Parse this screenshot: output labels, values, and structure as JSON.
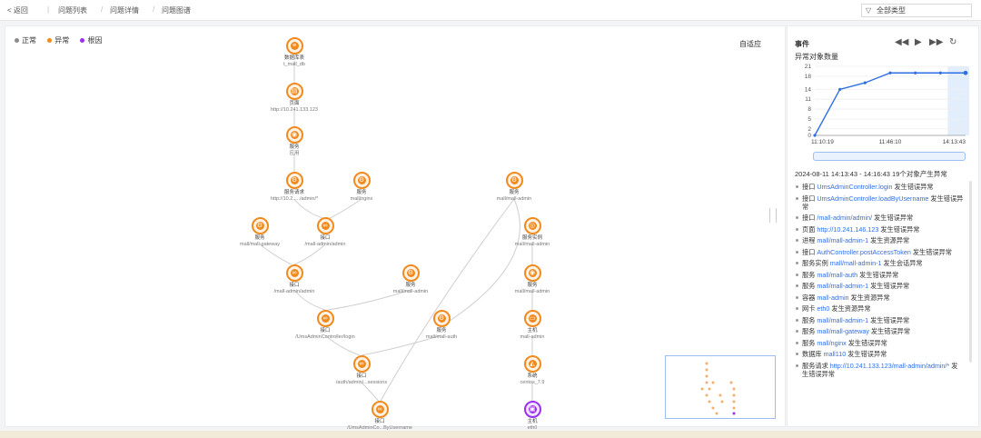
{
  "header": {
    "back": "< 返回",
    "breadcrumb": [
      "问题列表",
      "问题详情",
      "问题图谱"
    ],
    "filter_label": "全部类型"
  },
  "canvas": {
    "legend": [
      {
        "label": "正常",
        "color": "#8c8c8c"
      },
      {
        "label": "异常",
        "color": "#f08a1e"
      },
      {
        "label": "根因",
        "color": "#9b30f0"
      }
    ],
    "reset_label": "自适应",
    "nodes": [
      {
        "title": "数据库表",
        "sub": "t_mall_db"
      },
      {
        "title": "页面",
        "sub": "http://10.241.133.123"
      },
      {
        "title": "服务",
        "sub": "应用"
      },
      {
        "title": "服务请求",
        "sub": "http://10.2...../admin/*"
      },
      {
        "title": "服务",
        "sub": "mall/nginx"
      },
      {
        "title": "服务",
        "sub": "mall/mall-admin"
      },
      {
        "title": "服务",
        "sub": "mall/mall-gateway"
      },
      {
        "title": "接口",
        "sub": "/mall-admin/admin"
      },
      {
        "title": "服务实例",
        "sub": "mall/mall-admin"
      },
      {
        "title": "接口",
        "sub": "/mall-admin/admin"
      },
      {
        "title": "服务",
        "sub": "mall/mall-admin"
      },
      {
        "title": "服务",
        "sub": "mall/mall-admin"
      },
      {
        "title": "接口",
        "sub": "/UmsAdminController/login"
      },
      {
        "title": "服务",
        "sub": "mall/mall-auth"
      },
      {
        "title": "主机",
        "sub": "mall-admin"
      },
      {
        "title": "接口",
        "sub": "/auth/admin/...sessions"
      },
      {
        "title": "系统",
        "sub": "centos_7.9"
      },
      {
        "title": "接口",
        "sub": "/UmsAdminCo...ByUsername"
      },
      {
        "title": "主机",
        "sub": "eth0"
      }
    ]
  },
  "panel": {
    "title": "事件",
    "chart_title": "异常对象数量",
    "summary": "2024-08-11 14:13:43 - 14:16:43 19个对象产生异常",
    "events": [
      {
        "pre": "接口",
        "res": "UmsAdminController.login",
        "post": " 发生错误异常"
      },
      {
        "pre": "接口",
        "res": "UmsAdminController.loadByUsername",
        "post": " 发生错误异常"
      },
      {
        "pre": "接口",
        "res": "/mall-admin/admin/",
        "post": " 发生错误异常"
      },
      {
        "pre": "页面",
        "res": "http://10.241.146.123",
        "post": " 发生错误异常"
      },
      {
        "pre": "进程",
        "res": "mall/mall-admin-1",
        "post": " 发生资源异常"
      },
      {
        "pre": "接口",
        "res": "AuthController.postAccessToken",
        "post": " 发生错误异常"
      },
      {
        "pre": "服务实例",
        "res": "mall/mall-admin-1",
        "post": " 发生会话异常"
      },
      {
        "pre": "服务",
        "res": "mall/mall-auth",
        "post": " 发生错误异常"
      },
      {
        "pre": "服务",
        "res": "mall/mall-admin-1",
        "post": " 发生错误异常"
      },
      {
        "pre": "容器",
        "res": "mall-admin",
        "post": " 发生资源异常"
      },
      {
        "pre": "网卡",
        "res": "eth0",
        "post": " 发生资源异常"
      },
      {
        "pre": "服务",
        "res": "mall/mall-admin-1",
        "post": " 发生错误异常"
      },
      {
        "pre": "服务",
        "res": "mall/mall-gateway",
        "post": " 发生错误异常"
      },
      {
        "pre": "服务",
        "res": "mall/nginx",
        "post": " 发生错误异常"
      },
      {
        "pre": "数据库",
        "res": "mall110",
        "post": " 发生错误异常"
      },
      {
        "pre": "服务请求",
        "res": "http://10.241.133.123/mall-admin/admin/*",
        "post": " 发生错误异常"
      }
    ]
  },
  "chart_data": {
    "type": "line",
    "title": "异常对象数量",
    "x": [
      "11:10:19",
      "11:25:00",
      "11:40:00",
      "11:46:10",
      "12:40:00",
      "13:30:00",
      "14:13:43"
    ],
    "x_ticks": [
      "11:10:19",
      "11:46:10",
      "14:13:43"
    ],
    "y_ticks": [
      0,
      2,
      5,
      8,
      11,
      14,
      18,
      21
    ],
    "series": [
      {
        "values": [
          0,
          14,
          16,
          19,
          19,
          19,
          19
        ]
      }
    ],
    "ylim": [
      0,
      21
    ],
    "grid": true,
    "color": "#2f6fe4"
  }
}
